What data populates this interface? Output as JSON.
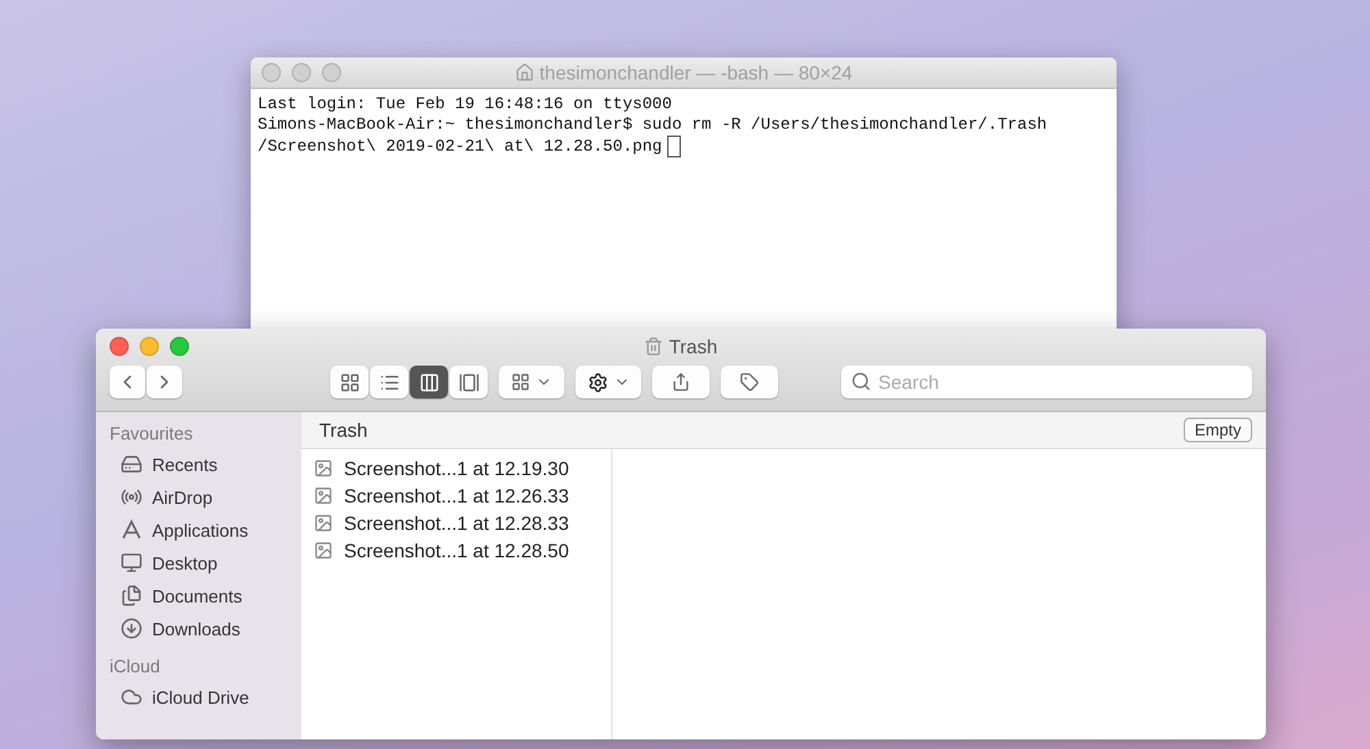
{
  "terminal": {
    "title": "thesimonchandler — -bash — 80×24",
    "lines": [
      "Last login: Tue Feb 19 16:48:16 on ttys000",
      "Simons-MacBook-Air:~ thesimonchandler$ sudo rm -R /Users/thesimonchandler/.Trash",
      "/Screenshot\\ 2019-02-21\\ at\\ 12.28.50.png"
    ]
  },
  "finder": {
    "title": "Trash",
    "view_modes": [
      {
        "kind": "icons",
        "selected": false
      },
      {
        "kind": "list",
        "selected": false
      },
      {
        "kind": "columns",
        "selected": true
      },
      {
        "kind": "gallery",
        "selected": false
      }
    ],
    "search": {
      "placeholder": "Search"
    },
    "sidebar": [
      {
        "heading": "Favourites",
        "items": [
          {
            "kind": "recents",
            "label": "Recents"
          },
          {
            "kind": "airdrop",
            "label": "AirDrop"
          },
          {
            "kind": "applications",
            "label": "Applications"
          },
          {
            "kind": "desktop",
            "label": "Desktop"
          },
          {
            "kind": "documents",
            "label": "Documents"
          },
          {
            "kind": "downloads",
            "label": "Downloads"
          }
        ]
      },
      {
        "heading": "iCloud",
        "items": [
          {
            "kind": "cloud",
            "label": "iCloud Drive"
          }
        ]
      }
    ],
    "column_header": "Trash",
    "empty_button": "Empty",
    "files": [
      {
        "name": "Screenshot...1 at 12.19.30"
      },
      {
        "name": "Screenshot...1 at 12.26.33"
      },
      {
        "name": "Screenshot...1 at 12.28.33"
      },
      {
        "name": "Screenshot...1 at 12.28.50"
      }
    ]
  }
}
